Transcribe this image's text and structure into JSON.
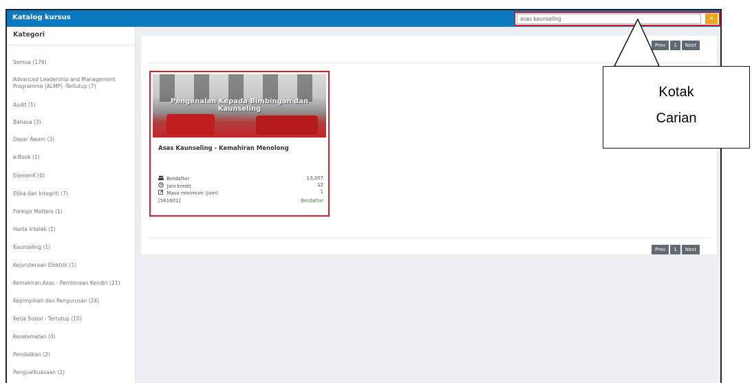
{
  "app": {
    "title": "Katalog kursus"
  },
  "search": {
    "value": "asas kaunseling",
    "clear_icon": "close-icon",
    "clear_label": "×"
  },
  "sidebar": {
    "title": "Kategori",
    "items": [
      "Semua (176)",
      "Advanced Leadership and Management Programme (ALMP) -Tertutup (7)",
      "Audit (1)",
      "Bahasa (3)",
      "Dasar Awam (3)",
      "e-Book (1)",
      "ElemenK (0)",
      "Etika dan Integriti (7)",
      "Foreign Matters (1)",
      "Harta Intelek (1)",
      "Kaunseling (1)",
      "Kejuruteraan Elektrik (1)",
      "Kemahiran Asas - Pembinaan Kendiri (21)",
      "Kepimpinan dan Pengurusan (24)",
      "Kerja Sosial - Tertutup (10)",
      "Keselamatan (4)",
      "Pendidikan (2)",
      "Penguatkuasaan (2)"
    ]
  },
  "pager": {
    "prev": "Prev",
    "page": "1",
    "next": "Next"
  },
  "course": {
    "image_text": "Pengenalan Kepada Bimbingan dan Kaunseling",
    "title": "Asas Kaunseling - Kemahiran Menolong",
    "stats": [
      {
        "icon": "users-icon",
        "label": "Berdaftar",
        "value": "13,207"
      },
      {
        "icon": "clock-icon",
        "label": "Jam kredit",
        "value": "12"
      },
      {
        "icon": "edit-icon",
        "label": "Masa minimum (Jam)",
        "value": "1"
      }
    ],
    "code": "[561601]",
    "status": "Berdaftar"
  },
  "callout": {
    "line1": "Kotak",
    "line2": "Carian"
  },
  "colors": {
    "header": "#0b79bf",
    "highlight": "#d21f2b",
    "clear_button": "#f0a41c",
    "pager": "#616a72"
  }
}
